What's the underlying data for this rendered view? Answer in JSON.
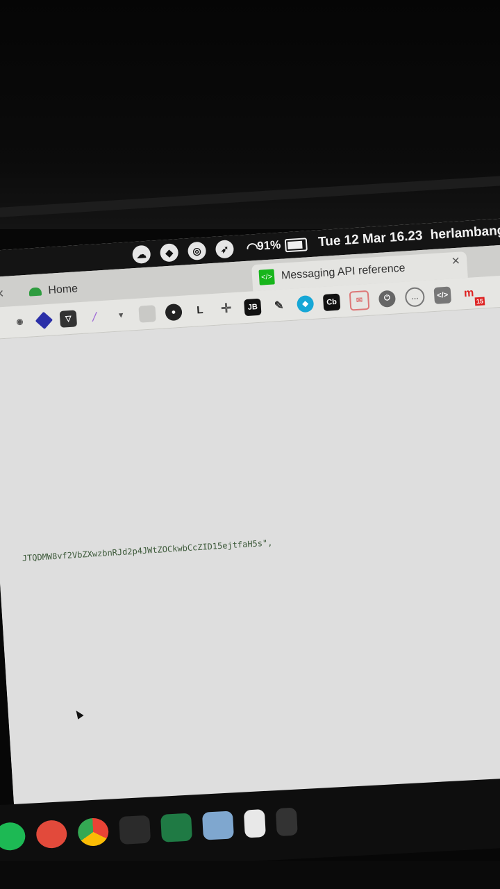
{
  "menubar": {
    "icons": [
      "creative-cloud-icon",
      "dropbox-icon",
      "scrollbar-icon",
      "rocket-icon",
      "wifi-icon"
    ],
    "battery_percent": "91%",
    "datetime": "Tue 12 Mar 16.23",
    "user": "herlambang"
  },
  "tabs": [
    {
      "label": "Home",
      "close": "×"
    },
    {
      "label": "Messaging API reference",
      "close": "×"
    }
  ],
  "new_tab": "+",
  "toolbar": {
    "ext_l": "L",
    "ext_jb": "JB",
    "ext_cb": "Cb",
    "ext_badge": "15"
  },
  "content": {
    "code_line": "JTQDMW8vf2VbZXwzbnRJd2p4JWtZOCkwbCcZID15ejtfaH5s\","
  },
  "colors": {
    "screen_bg": "#dedede",
    "menubar_bg": "#141414",
    "code_text": "#3d5a3a",
    "api_icon": "#17b51b"
  }
}
